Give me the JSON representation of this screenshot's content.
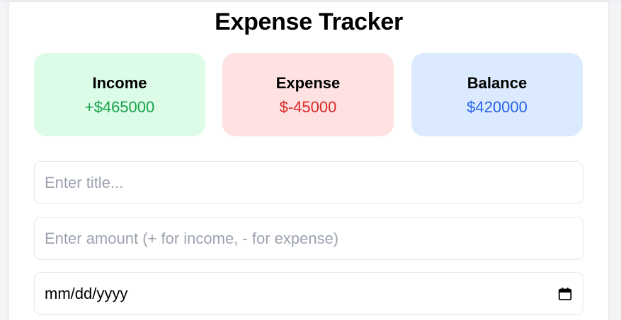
{
  "app": {
    "title": "Expense Tracker"
  },
  "summary": {
    "income": {
      "label": "Income",
      "value": "+$465000",
      "color": "#16a34a",
      "bg": "#dcfce7"
    },
    "expense": {
      "label": "Expense",
      "value": "$-45000",
      "color": "#dc2626",
      "bg": "#fee2e2"
    },
    "balance": {
      "label": "Balance",
      "value": "$420000",
      "color": "#2563eb",
      "bg": "#dbeafe"
    }
  },
  "form": {
    "title_input": {
      "value": "",
      "placeholder": "Enter title..."
    },
    "amount_input": {
      "value": "",
      "placeholder": "Enter amount (+ for income, - for expense)"
    },
    "date_input": {
      "value": "mm/dd/yyyy",
      "icon": "calendar-icon"
    }
  }
}
